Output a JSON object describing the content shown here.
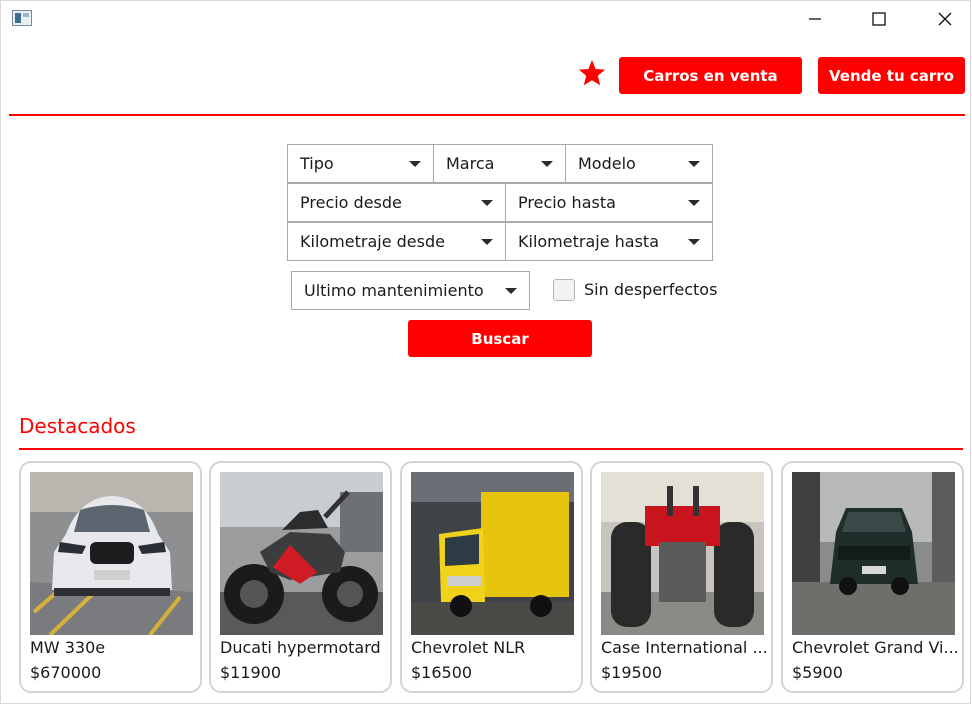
{
  "header": {
    "sale_label": "Carros en venta",
    "sell_label": "Vende tu carro"
  },
  "filters": {
    "tipo": "Tipo",
    "marca": "Marca",
    "modelo": "Modelo",
    "precio_desde": "Precio desde",
    "precio_hasta": "Precio hasta",
    "km_desde": "Kilometraje desde",
    "km_hasta": "Kilometraje hasta",
    "mantenimiento": "Ultimo mantenimiento",
    "sin_desperfectos": "Sin desperfectos",
    "sin_desperfectos_checked": false,
    "search_label": "Buscar"
  },
  "featured": {
    "title": "Destacados",
    "items": [
      {
        "name": "MW 330e",
        "price": "$670000",
        "image": "white-bmw-sedan"
      },
      {
        "name": "Ducati hypermotard",
        "price": "$11900",
        "image": "ducati-motorcycle"
      },
      {
        "name": "Chevrolet NLR",
        "price": "$16500",
        "image": "yellow-box-truck"
      },
      {
        "name": "Case International ...",
        "price": "$19500",
        "image": "red-tractor"
      },
      {
        "name": "Chevrolet Grand Vi...",
        "price": "$5900",
        "image": "dark-green-suv"
      }
    ]
  },
  "colors": {
    "accent": "#ff0000",
    "border": "#aaaaaa",
    "card_border": "#d4d4d4"
  }
}
